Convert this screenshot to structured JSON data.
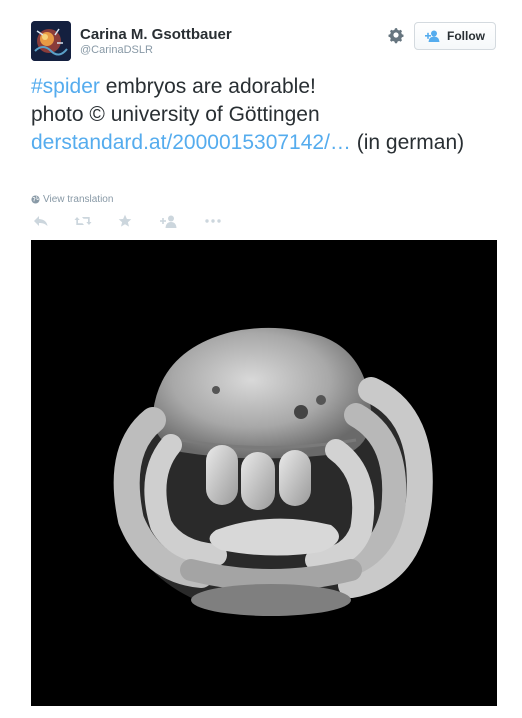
{
  "author": {
    "name": "Carina M. Gsottbauer",
    "handle": "@CarinaDSLR"
  },
  "header": {
    "follow_label": "Follow",
    "settings_icon": "gear-icon"
  },
  "tweet": {
    "hashtag": "#spider",
    "line1_rest": " embryos are adorable!",
    "line2": "photo © university of Göttingen",
    "link_text": "derstandard.at/2000015307142/…",
    "link_suffix": " (in german)"
  },
  "translation": {
    "label": "View translation"
  },
  "actions": [
    {
      "icon": "reply-icon"
    },
    {
      "icon": "retweet-icon"
    },
    {
      "icon": "favorite-star-icon"
    },
    {
      "icon": "follow-user-icon"
    },
    {
      "icon": "more-icon"
    }
  ],
  "colors": {
    "link": "#55acee",
    "text": "#292f33",
    "muted": "#8899a6",
    "icon": "#ccd6dd"
  }
}
